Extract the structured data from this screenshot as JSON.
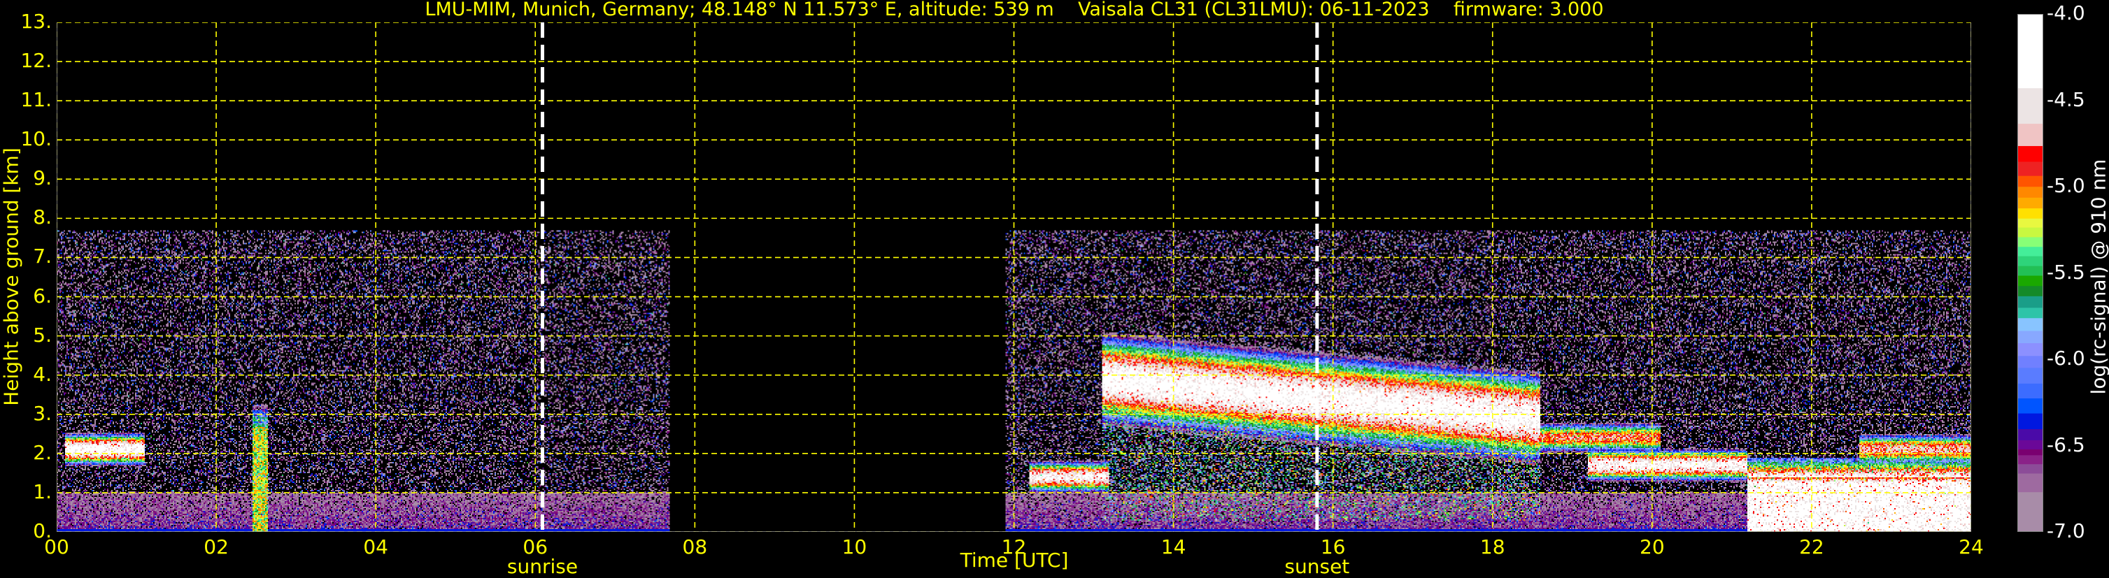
{
  "chart_data": {
    "type": "heatmap",
    "title": "LMU-MIM, Munich, Germany; 48.148° N 11.573° E, altitude: 539 m    Vaisala CL31 (CL31LMU): 06-11-2023    firmware: 3.000",
    "xlabel": "Time [UTC]",
    "ylabel": "Height above ground [km]",
    "xlim": [
      0,
      24
    ],
    "ylim": [
      0,
      13
    ],
    "grid": true,
    "x_ticks": [
      0,
      2,
      4,
      6,
      8,
      10,
      12,
      14,
      16,
      18,
      20,
      22,
      24
    ],
    "x_tick_labels": [
      "00",
      "02",
      "04",
      "06",
      "08",
      "10",
      "12",
      "14",
      "16",
      "18",
      "20",
      "22",
      "24"
    ],
    "y_ticks": [
      0,
      1,
      2,
      3,
      4,
      5,
      6,
      7,
      8,
      9,
      10,
      11,
      12,
      13
    ],
    "y_tick_labels": [
      "0.",
      "1.",
      "2.",
      "3.",
      "4.",
      "5.",
      "6.",
      "7.",
      "8.",
      "9.",
      "10.",
      "11.",
      "12.",
      "13."
    ],
    "markers": [
      {
        "label": "sunrise",
        "time": 6.09
      },
      {
        "label": "sunset",
        "time": 15.8
      }
    ],
    "data_periods": [
      [
        0,
        7.69
      ],
      [
        11.9,
        24
      ]
    ],
    "max_range_km": 7.7,
    "colorbar": {
      "label": "log(rc-signal) @ 910 nm",
      "range": [
        -7.0,
        -4.0
      ],
      "ticks": [
        -4.0,
        -4.5,
        -5.0,
        -5.5,
        -6.0,
        -6.5,
        -7.0
      ],
      "tick_labels": [
        "-4.0",
        "-4.5",
        "-5.0",
        "-5.5",
        "-6.0",
        "-6.5",
        "-7.0"
      ],
      "boundaries": [
        -4.0,
        -4.426,
        -4.632,
        -4.761,
        -4.852,
        -4.934,
        -4.997,
        -5.06,
        -5.122,
        -5.181,
        -5.233,
        -5.289,
        -5.345,
        -5.399,
        -5.456,
        -5.512,
        -5.572,
        -5.631,
        -5.698,
        -5.758,
        -5.832,
        -5.903,
        -5.977,
        -6.046,
        -6.137,
        -6.223,
        -6.31,
        -6.401,
        -6.465,
        -6.518,
        -6.552,
        -6.604,
        -6.658,
        -6.766,
        -7.0
      ],
      "colors": [
        "#ffffff",
        "#ece4e4",
        "#f0c4c4",
        "#ff0000",
        "#ee2222",
        "#ff5500",
        "#ff8800",
        "#ffaa00",
        "#ffe000",
        "#e8f840",
        "#c8f840",
        "#88ff77",
        "#44ee99",
        "#2ed47a",
        "#22c055",
        "#1aa800",
        "#148a28",
        "#1a9e88",
        "#2ec4a8",
        "#88c4ff",
        "#88a8ff",
        "#8c90ff",
        "#7080ff",
        "#5a7cff",
        "#3c6cff",
        "#0055ff",
        "#0018e0",
        "#4a0aa8",
        "#6a0898",
        "#7a0070",
        "#8a2288",
        "#8c4c98",
        "#9e6aa0",
        "#a88ca8"
      ]
    },
    "features": [
      {
        "kind": "cloud",
        "t": [
          0.1,
          1.1
        ],
        "height_km": 2.1,
        "value": -4.0
      },
      {
        "kind": "plume",
        "t": [
          2.45,
          2.65
        ],
        "height_km": [
          0,
          2.8
        ],
        "value": -5.0
      },
      {
        "kind": "layer",
        "t": [
          12.2,
          13.2
        ],
        "height_km": 1.4,
        "value": -4.2
      },
      {
        "kind": "elevated-layer",
        "t": [
          13.1,
          18.6
        ],
        "height_km": [
          3.9,
          2.9
        ],
        "value": -4.0
      },
      {
        "kind": "layer",
        "t": [
          18.6,
          20.1
        ],
        "height_km": 2.4,
        "value": -4.6
      },
      {
        "kind": "layer",
        "t": [
          19.2,
          21.2
        ],
        "height_km": 1.7,
        "value": -4.1
      },
      {
        "kind": "low-cloud",
        "t": [
          21.2,
          24
        ],
        "height_km": [
          0,
          1.4
        ],
        "value": -4.0
      },
      {
        "kind": "cloud-top",
        "t": [
          22.6,
          24
        ],
        "height_km": 2.1,
        "value": -4.5
      }
    ],
    "colors": {
      "text": "#ffff00",
      "grid": "#ffff00",
      "marker": "#ffffff",
      "background": "#000000"
    }
  }
}
